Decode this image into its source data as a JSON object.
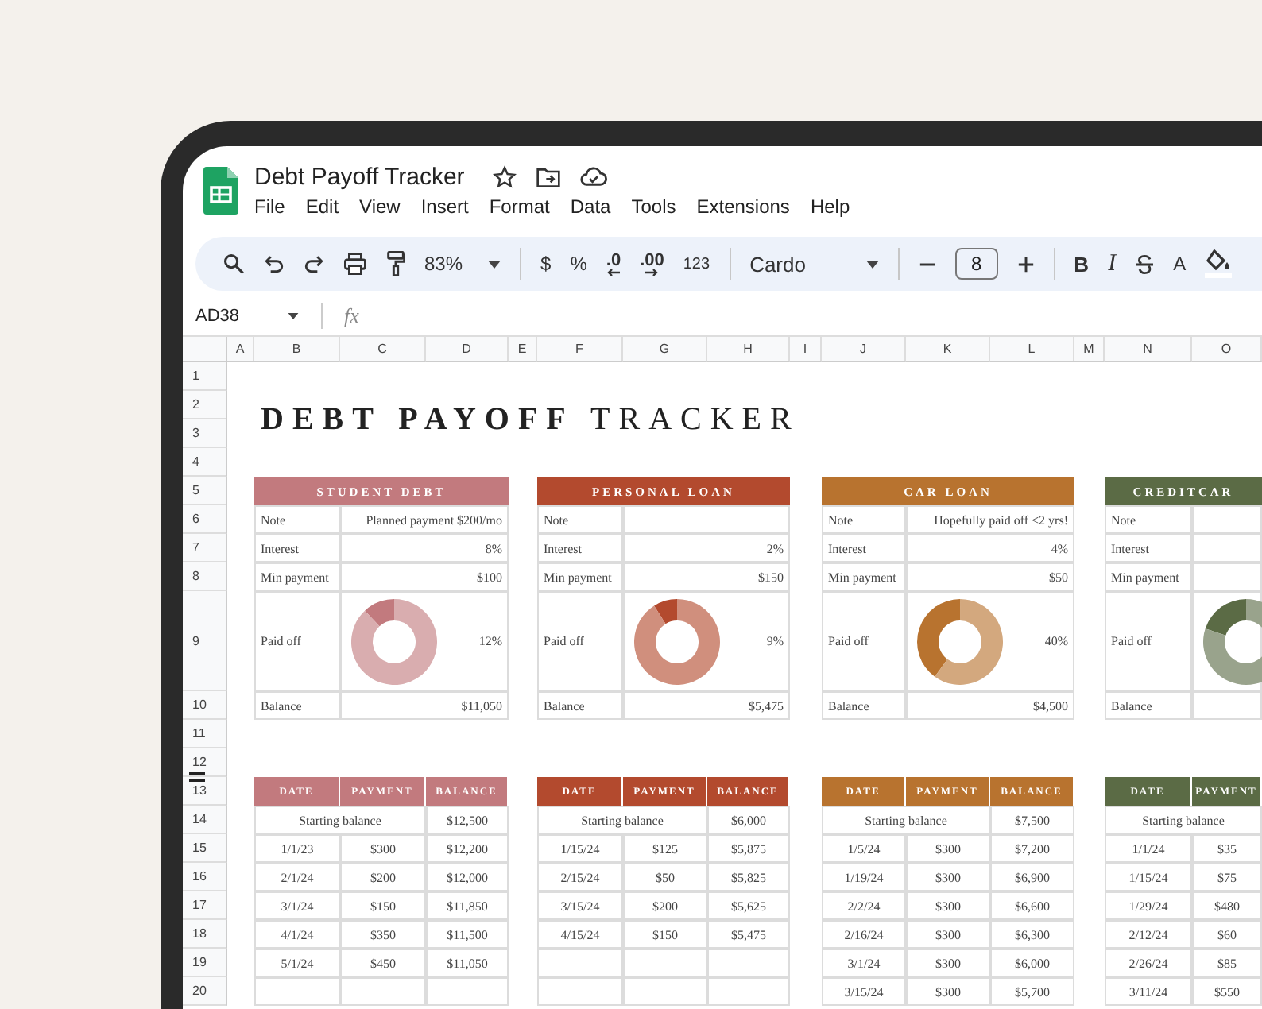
{
  "document": {
    "title": "Debt Payoff Tracker"
  },
  "menu": [
    "File",
    "Edit",
    "View",
    "Insert",
    "Format",
    "Data",
    "Tools",
    "Extensions",
    "Help"
  ],
  "toolbar": {
    "zoom": "83%",
    "currency": "$",
    "percent": "%",
    "decrease_decimals": ".0",
    "increase_decimals": ".00",
    "number_format": "123",
    "font": "Cardo",
    "font_size": "8",
    "bold": "B",
    "italic": "I",
    "text_color": "A"
  },
  "formula_bar": {
    "cell": "AD38",
    "fx": "fx"
  },
  "columns": [
    "A",
    "B",
    "C",
    "D",
    "E",
    "F",
    "G",
    "H",
    "I",
    "J",
    "K",
    "L",
    "M",
    "N",
    "O"
  ],
  "rows": [
    "1",
    "2",
    "3",
    "4",
    "5",
    "6",
    "7",
    "8",
    "9",
    "10",
    "11",
    "12",
    "13",
    "14",
    "15",
    "16",
    "17",
    "18",
    "19",
    "20"
  ],
  "sheet_title": "**DEBT PAYOFF** TRACKER",
  "debts": [
    {
      "name": "STUDENT DEBT",
      "color": "#c27a7e",
      "fields": [
        {
          "label": "Note",
          "value": "Planned payment $200/mo"
        },
        {
          "label": "Interest",
          "value": "8%"
        },
        {
          "label": "Min payment",
          "value": "$100"
        }
      ],
      "paid_off": {
        "label": "Paid off",
        "value": "12%",
        "chart_data": {
          "type": "donut",
          "values": [
            12,
            88
          ]
        }
      },
      "balance": {
        "label": "Balance",
        "value": "$11,050"
      },
      "log": {
        "columns": [
          "DATE",
          "PAYMENT",
          "BALANCE"
        ],
        "start": {
          "label": "Starting balance",
          "balance": "$12,500"
        },
        "payments": [
          {
            "date": "1/1/23",
            "payment": "$300",
            "balance": "$12,200"
          },
          {
            "date": "2/1/24",
            "payment": "$200",
            "balance": "$12,000"
          },
          {
            "date": "3/1/24",
            "payment": "$150",
            "balance": "$11,850"
          },
          {
            "date": "4/1/24",
            "payment": "$350",
            "balance": "$11,500"
          },
          {
            "date": "5/1/24",
            "payment": "$450",
            "balance": "$11,050"
          }
        ]
      }
    },
    {
      "name": "PERSONAL LOAN",
      "color": "#b34a2e",
      "fields": [
        {
          "label": "Note"
        },
        {
          "label": "Interest",
          "value": "2%"
        },
        {
          "label": "Min payment",
          "value": "$150"
        }
      ],
      "paid_off": {
        "label": "Paid off",
        "value": "9%",
        "chart_data": {
          "type": "donut",
          "values": [
            9,
            91
          ]
        }
      },
      "balance": {
        "label": "Balance",
        "value": "$5,475"
      },
      "log": {
        "columns": [
          "DATE",
          "PAYMENT",
          "BALANCE"
        ],
        "start": {
          "label": "Starting balance",
          "balance": "$6,000"
        },
        "payments": [
          {
            "date": "1/15/24",
            "payment": "$125",
            "balance": "$5,875"
          },
          {
            "date": "2/15/24",
            "payment": "$50",
            "balance": "$5,825"
          },
          {
            "date": "3/15/24",
            "payment": "$200",
            "balance": "$5,625"
          },
          {
            "date": "4/15/24",
            "payment": "$150",
            "balance": "$5,475"
          }
        ]
      }
    },
    {
      "name": "CAR LOAN",
      "color": "#b8732f",
      "fields": [
        {
          "label": "Note",
          "value": "Hopefully paid off <2 yrs!"
        },
        {
          "label": "Interest",
          "value": "4%"
        },
        {
          "label": "Min payment",
          "value": "$50"
        }
      ],
      "paid_off": {
        "label": "Paid off",
        "value": "40%",
        "chart_data": {
          "type": "donut",
          "values": [
            40,
            60
          ]
        }
      },
      "balance": {
        "label": "Balance",
        "value": "$4,500"
      },
      "log": {
        "columns": [
          "DATE",
          "PAYMENT",
          "BALANCE"
        ],
        "start": {
          "label": "Starting balance",
          "balance": "$7,500"
        },
        "payments": [
          {
            "date": "1/5/24",
            "payment": "$300",
            "balance": "$7,200"
          },
          {
            "date": "1/19/24",
            "payment": "$300",
            "balance": "$6,900"
          },
          {
            "date": "2/2/24",
            "payment": "$300",
            "balance": "$6,600"
          },
          {
            "date": "2/16/24",
            "payment": "$300",
            "balance": "$6,300"
          },
          {
            "date": "3/1/24",
            "payment": "$300",
            "balance": "$6,000"
          },
          {
            "date": "3/15/24",
            "payment": "$300",
            "balance": "$5,700"
          }
        ]
      }
    },
    {
      "name": "CREDITCAR",
      "color": "#5b6b45",
      "fields": [
        {
          "label": "Note"
        },
        {
          "label": "Interest"
        },
        {
          "label": "Min payment"
        }
      ],
      "paid_off": {
        "label": "Paid off"
      },
      "balance": {
        "label": "Balance"
      },
      "log": {
        "columns": [
          "DATE",
          "PAYMENT"
        ],
        "start": {
          "label": "Starting balance"
        },
        "payments": [
          {
            "date": "1/1/24",
            "payment": "$35"
          },
          {
            "date": "1/15/24",
            "payment": "$75"
          },
          {
            "date": "1/29/24",
            "payment": "$480"
          },
          {
            "date": "2/12/24",
            "payment": "$60"
          },
          {
            "date": "2/26/24",
            "payment": "$85"
          },
          {
            "date": "3/11/24",
            "payment": "$550"
          }
        ]
      }
    }
  ]
}
